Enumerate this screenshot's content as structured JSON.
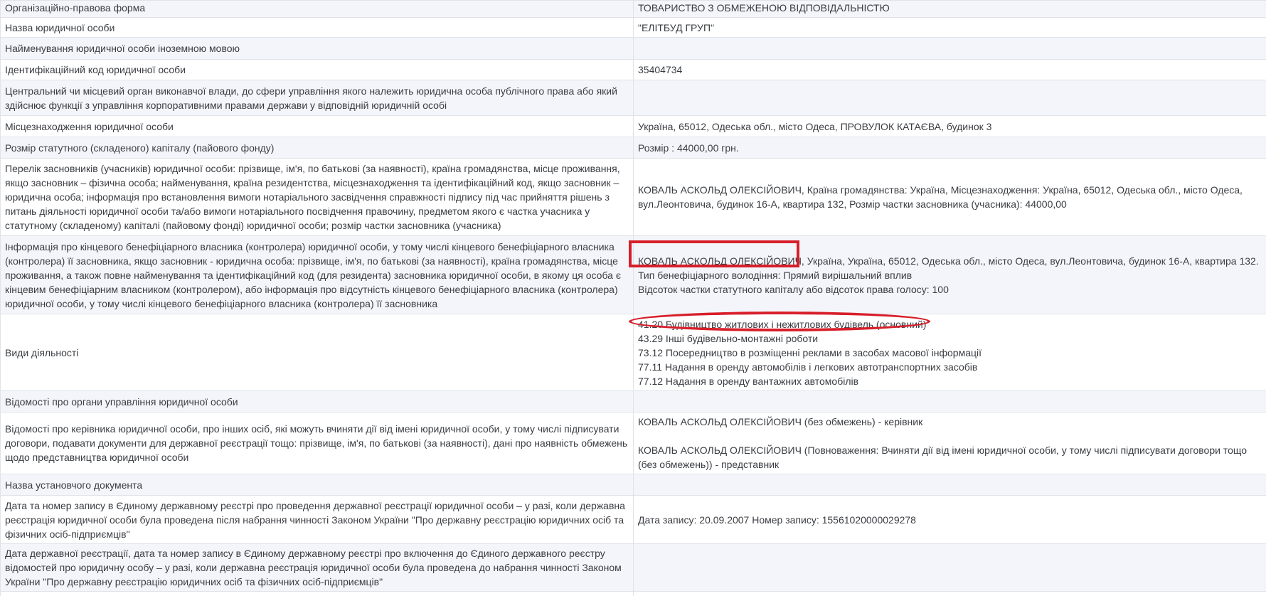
{
  "rows": [
    {
      "label": "Організаційно-правова форма",
      "value": [
        "ТОВАРИСТВО З ОБМЕЖЕНОЮ ВІДПОВІДАЛЬНІСТЮ"
      ]
    },
    {
      "label": "Назва юридичної особи",
      "value": [
        "\"ЕЛІТБУД ГРУП\""
      ]
    },
    {
      "label": "Найменування юридичної особи іноземною мовою",
      "value": []
    },
    {
      "label": "Ідентифікаційний код юридичної особи",
      "value": [
        "35404734"
      ]
    },
    {
      "label": "Центральний чи місцевий орган виконавчої влади, до сфери управління якого належить юридична особа публічного права або який здійснює функції з управління корпоративними правами держави у відповідній юридичній особі",
      "value": []
    },
    {
      "label": "Місцезнаходження юридичної особи",
      "value": [
        "Україна, 65012, Одеська обл., місто Одеса, ПРОВУЛОК КАТАЄВА, будинок 3"
      ]
    },
    {
      "label": "Розмір статутного (складеного) капіталу (пайового фонду)",
      "value": [
        "Розмір : 44000,00 грн."
      ]
    },
    {
      "label": "Перелік засновників (учасників) юридичної особи: прізвище, ім'я, по батькові (за наявності), країна громадянства, місце проживання, якщо засновник – фізична особа; найменування, країна резидентства, місцезнаходження та ідентифікаційний код, якщо засновник – юридична особа; інформація про встановлення вимоги нотаріального засвідчення справжності підпису під час прийняття рішень з питань діяльності юридичної особи та/або вимоги нотаріального посвідчення правочину, предметом якого є частка учасника у статутному (складеному) капіталі (пайовому фонді) юридичної особи; розмір частки засновника (учасника)",
      "value": [
        "КОВАЛЬ АСКОЛЬД ОЛЕКСІЙОВИЧ, Країна громадянства: Україна, Місцезнаходження: Україна, 65012, Одеська обл., місто Одеса, вул.Леонтовича, будинок 16-А, квартира 132, Розмір частки засновника (учасника): 44000,00"
      ]
    },
    {
      "label": "Інформація про кінцевого бенефіціарного власника (контролера) юридичної особи, у тому числі кінцевого бенефіціарного власника (контролера) її засновника, якщо засновник - юридична особа: прізвище, ім'я, по батькові (за наявності), країна громадянства, місце проживання, а також повне найменування та ідентифікаційний код (для резидента) засновника юридичної особи, в якому ця особа є кінцевим бенефіціарним власником (контролером), або інформація про відсутність кінцевого бенефіціарного власника (контролера) юридичної особи, у тому числі кінцевого бенефіціарного власника (контролера) її засновника",
      "value": [
        "КОВАЛЬ АСКОЛЬД ОЛЕКСІЙОВИЧ, Україна, Україна, 65012, Одеська обл., місто Одеса, вул.Леонтовича, будинок 16-А, квартира 132.",
        "Тип бенефіціарного володіння: Прямий вирішальний вплив",
        "Відсоток частки статутного капіталу або відсоток права голосу: 100"
      ]
    },
    {
      "label": "Види діяльності",
      "value": [
        "41.20 Будівництво житлових і нежитлових будівель (основний)",
        "43.29 Інші будівельно-монтажні роботи",
        "73.12 Посередництво в розміщенні реклами в засобах масової інформації",
        "77.11 Надання в оренду автомобілів і легкових автотранспортних засобів",
        "77.12 Надання в оренду вантажних автомобілів"
      ]
    },
    {
      "label": "Відомості про органи управління юридичної особи",
      "value": []
    },
    {
      "label": "Відомості про керівника юридичної особи, про інших осіб, які можуть вчиняти дії від імені юридичної особи, у тому числі підписувати договори, подавати документи для державної реєстрації тощо: прізвище, ім'я, по батькові (за наявності), дані про наявність обмежень щодо представництва юридичної особи",
      "value": [
        "КОВАЛЬ АСКОЛЬД ОЛЕКСІЙОВИЧ (без обмежень) - керівник",
        "",
        "КОВАЛЬ АСКОЛЬД ОЛЕКСІЙОВИЧ (Повноваження: Вчиняти дії від імені юридичної особи, у тому числі підписувати договори тощо (без обмежень)) - представник"
      ]
    },
    {
      "label": "Назва установчого документа",
      "value": []
    },
    {
      "label": "Дата та номер запису в Єдиному державному реєстрі про проведення державної реєстрації юридичної особи – у разі, коли державна реєстрація юридичної особи була проведена після набрання чинності Законом України \"Про державну реєстрацію юридичних осіб та фізичних осіб-підприємців\"",
      "value": [
        "Дата запису: 20.09.2007 Номер запису: 15561020000029278"
      ]
    },
    {
      "label": "Дата державної реєстрації, дата та номер запису в Єдиному державному реєстрі про включення до Єдиного державного реєстру відомостей про юридичну особу – у разі, коли державна реєстрація юридичної особи була проведена до набрання чинності Законом України \"Про державну реєстрацію юридичних осіб та фізичних осіб-підприємців\"",
      "value": []
    },
    {
      "label": "",
      "value": []
    }
  ],
  "annotations": [
    {
      "type": "rectangle",
      "color": "#d71f2a",
      "target": "КОВАЛЬ АСКОЛЬД ОЛЕКСІЙОВИЧ"
    },
    {
      "type": "ellipse",
      "color": "#d71f2a",
      "target": "41.20 Будівництво житлових і нежитлових будівель (основний)"
    }
  ]
}
